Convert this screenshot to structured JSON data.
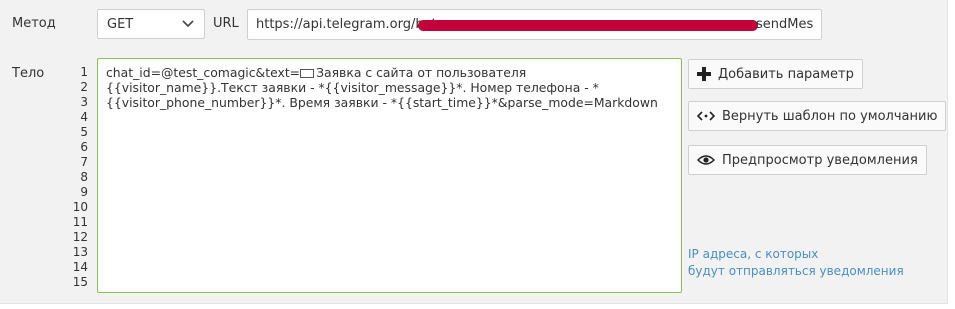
{
  "method": {
    "label": "Метод",
    "value": "GET"
  },
  "url": {
    "label": "URL",
    "value_visible_start": "https://api.telegram.org/bot",
    "value_visible_end": "sendMes"
  },
  "body": {
    "label": "Тело",
    "line_numbers": [
      "1",
      "2",
      "3",
      "4",
      "5",
      "6",
      "7",
      "8",
      "9",
      "10",
      "11",
      "12",
      "13",
      "14",
      "15"
    ],
    "line1_pre": "chat_id=@test_comagic&text=",
    "line1_post": "Заявка с сайта от пользователя {{visitor_name}}.Текст заявки - *{{visitor_message}}*. Номер телефона - *{{visitor_phone_number}}*. Время заявки - *{{start_time}}*&parse_mode=Markdown"
  },
  "buttons": {
    "add_param": "Добавить параметр",
    "reset_template": "Вернуть шаблон по умолчанию",
    "preview": "Предпросмотр уведомления"
  },
  "ip_link": {
    "line1": "IP адреса, с которых",
    "line2": "будут отправляться уведомления"
  },
  "colors": {
    "link": "#4a8fc4",
    "editor_border": "#8bc34a",
    "redaction": "#c2003a"
  },
  "icons": {
    "add": "plus-icon",
    "reset": "code-reset-icon",
    "preview": "eye-icon",
    "select": "chevron-down-icon"
  }
}
